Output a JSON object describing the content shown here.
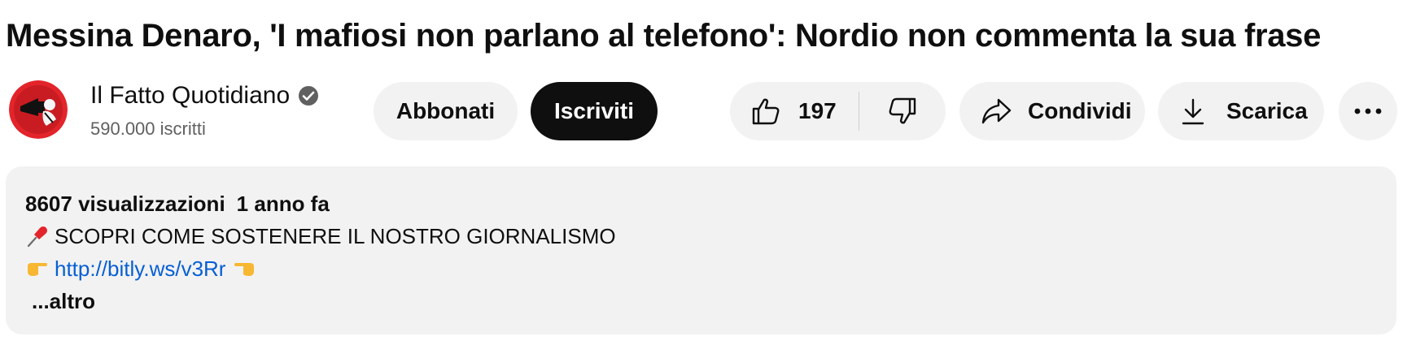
{
  "video": {
    "title": "Messina Denaro, 'I mafiosi non parlano al telefono': Nordio non commenta la sua frase"
  },
  "channel": {
    "name": "Il Fatto Quotidiano",
    "subscribers": "590.000 iscritti",
    "avatar_icon": "megaphone-logo-icon",
    "verified_icon": "verified-check-icon"
  },
  "actions": {
    "abbonati_label": "Abbonati",
    "subscribe_label": "Iscriviti",
    "like_count": "197",
    "share_label": "Condividi",
    "download_label": "Scarica"
  },
  "description": {
    "views": "8607 visualizzazioni",
    "date": "1 anno fa",
    "line1_text": "SCOPRI COME SOSTENERE IL NOSTRO GIORNALISMO",
    "link_text": "http://bitly.ws/v3Rr",
    "more_label": "...altro"
  },
  "colors": {
    "accent_red": "#e3242b",
    "link_blue": "#065fd4",
    "button_bg": "#f2f2f2",
    "subscribe_bg": "#0f0f0f"
  }
}
